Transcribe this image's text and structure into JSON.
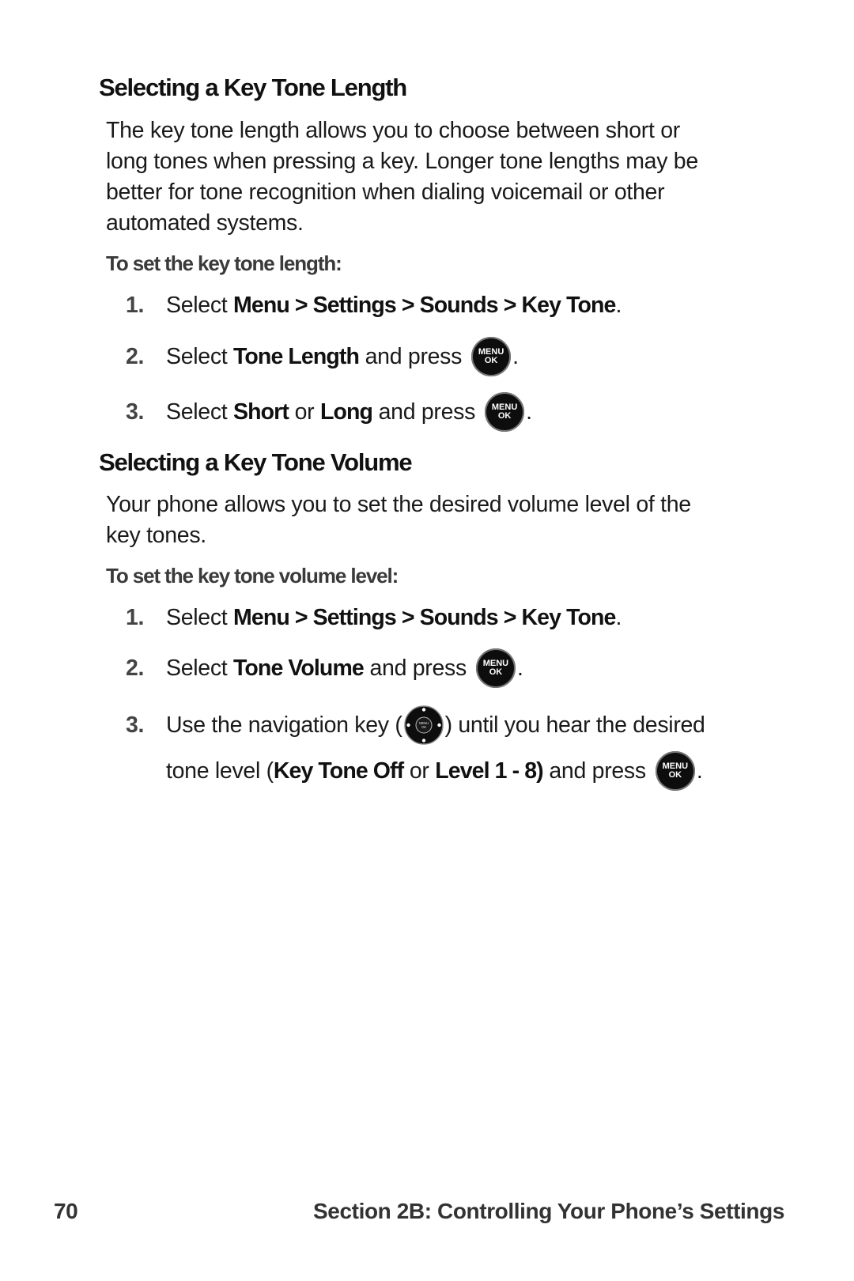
{
  "section1": {
    "heading": "Selecting a Key Tone Length",
    "body_lines": [
      "The key tone length allows you to choose between short or",
      "long tones when pressing a key. Longer tone lengths may be",
      "better for tone recognition when dialing voicemail or other",
      "automated systems."
    ],
    "subheading": "To set the key tone length:",
    "steps": [
      {
        "num": "1.",
        "t1": "Select ",
        "b1": "Menu > Settings > Sounds > Key Tone",
        "t2": "."
      },
      {
        "num": "2.",
        "t1": "Select ",
        "b1": "Tone Length",
        "t2": " and press",
        "end": "."
      },
      {
        "num": "3.",
        "t1": "Select ",
        "b1": "Short",
        "t2": " or ",
        "b2": "Long",
        "t3": " and press",
        "end": "."
      }
    ]
  },
  "section2": {
    "heading": "Selecting a Key Tone Volume",
    "body_lines": [
      "Your phone allows you to set the desired volume level of the",
      "key tones."
    ],
    "subheading": "To set the key tone volume level:",
    "steps": [
      {
        "num": "1.",
        "t1": "Select ",
        "b1": "Menu > Settings > Sounds > Key Tone",
        "t2": "."
      },
      {
        "num": "2.",
        "t1": "Select ",
        "b1": "Tone Volume",
        "t2": " and press",
        "end": "."
      },
      {
        "num": "3.",
        "t1": "Use the navigation key (",
        "t2": ") until you hear the desired"
      },
      {
        "t1": "tone level (",
        "b1": "Key Tone Off",
        "t2": " or ",
        "b2": "Level 1 - 8)",
        "t3": " and press",
        "end": "."
      }
    ]
  },
  "icons": {
    "menu_ok_top": "MENU",
    "menu_ok_bottom": "OK",
    "nav_key_inner": "MENU OK"
  },
  "footer": {
    "page_number": "70",
    "section_title": "Section 2B: Controlling Your Phone’s Settings"
  }
}
